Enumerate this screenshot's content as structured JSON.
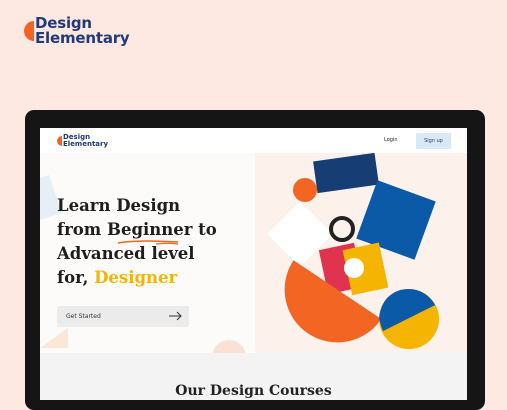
{
  "brand": {
    "line1": "Design",
    "line2": "Elementary"
  },
  "site": {
    "logo": {
      "line1": "Design",
      "line2": "Elementary"
    },
    "nav": {
      "login": "Login",
      "signup": "Sign up"
    },
    "hero": {
      "line1": "Learn Design",
      "line2": "from Beginner to",
      "line3": "Advanced level",
      "line4_prefix": "for, ",
      "line4_accent": "Designer",
      "cta": "Get Started"
    },
    "courses_title": "Our Design Courses"
  },
  "colors": {
    "brand_navy": "#233a7a",
    "brand_orange": "#f26522",
    "accent_yellow": "#f5b400",
    "blue": "#0a5aa8",
    "page_bg": "#fde9e2"
  },
  "icons": {
    "arrow": "arrow-right-icon"
  }
}
